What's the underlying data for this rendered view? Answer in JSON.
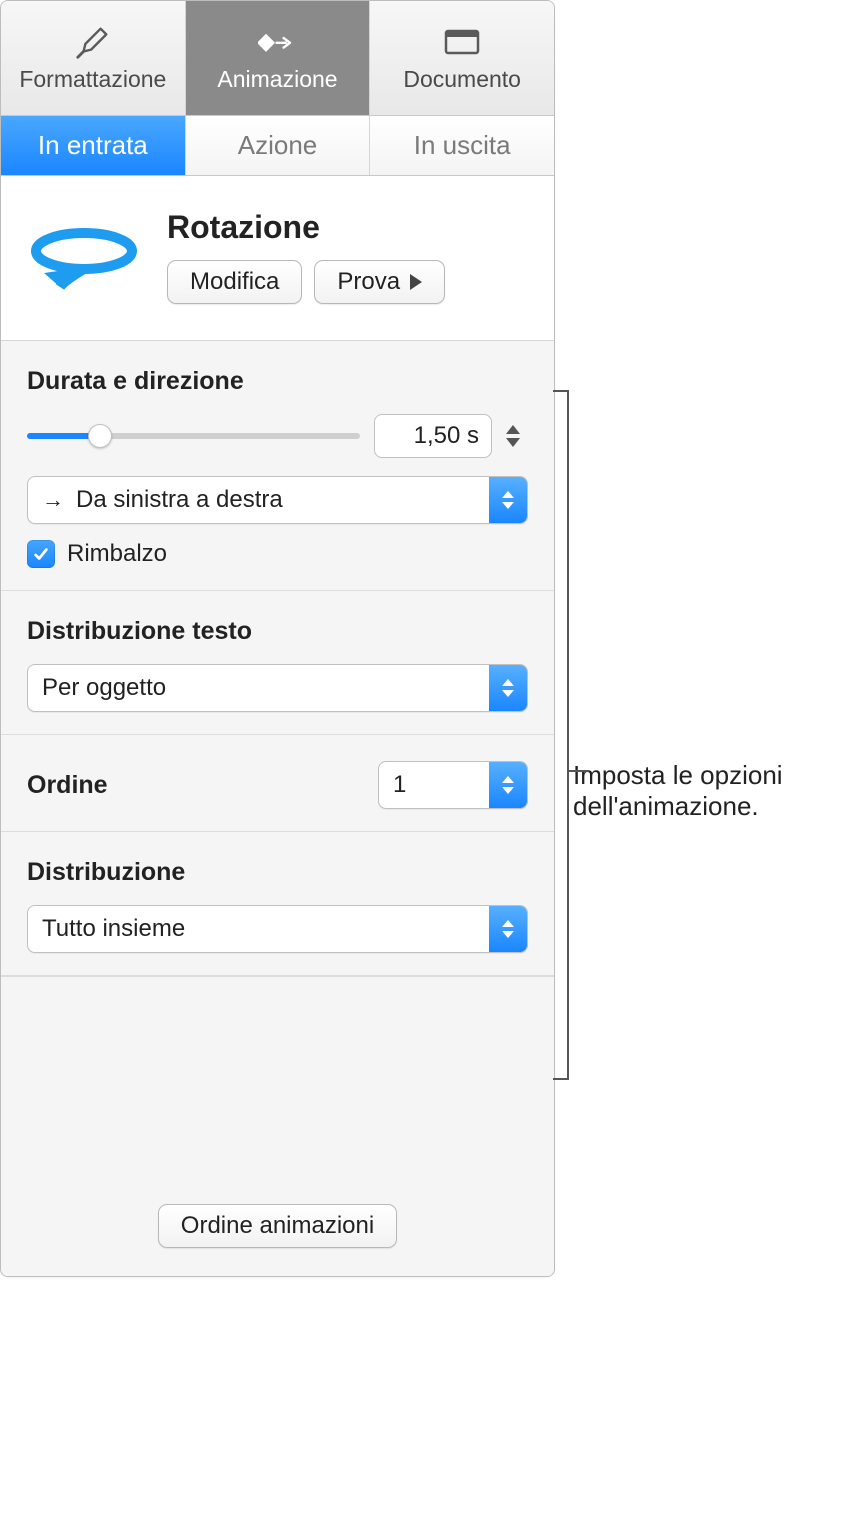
{
  "toolbar": {
    "format": "Formattazione",
    "animate": "Animazione",
    "document": "Documento"
  },
  "tabs": {
    "in": "In entrata",
    "action": "Azione",
    "out": "In uscita"
  },
  "effect": {
    "title": "Rotazione",
    "modify": "Modifica",
    "preview": "Prova"
  },
  "duration": {
    "label": "Durata e direzione",
    "value": "1,50 s",
    "direction": "Da sinistra a destra",
    "bounce": "Rimbalzo"
  },
  "text_delivery": {
    "label": "Distribuzione testo",
    "value": "Per oggetto"
  },
  "order": {
    "label": "Ordine",
    "value": "1"
  },
  "delivery": {
    "label": "Distribuzione",
    "value": "Tutto insieme"
  },
  "footer": {
    "build_order": "Ordine animazioni"
  },
  "callout": "Imposta le opzioni dell'animazione."
}
